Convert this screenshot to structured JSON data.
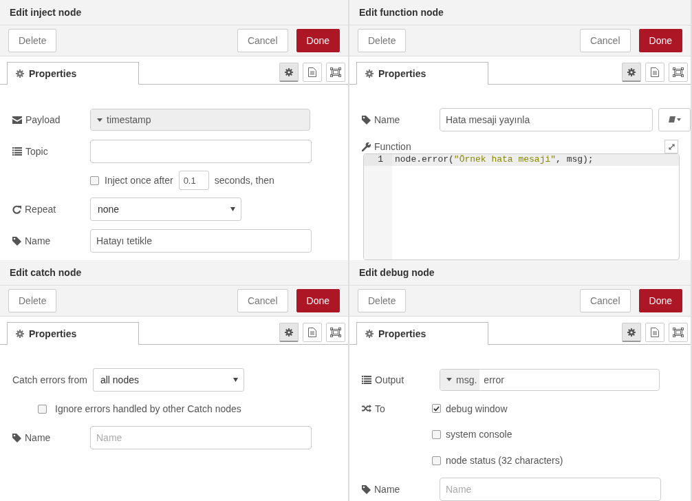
{
  "panels": [
    {
      "title": "Edit inject node",
      "buttons": {
        "delete": "Delete",
        "cancel": "Cancel",
        "done": "Done"
      },
      "tab": {
        "label": "Properties",
        "selected": true
      },
      "view_buttons": [
        {
          "selected": true
        },
        {
          "selected": false
        },
        {
          "selected": false
        }
      ],
      "rows": [
        {
          "kind": "typed",
          "label": "Payload",
          "type_label": "timestamp"
        },
        {
          "kind": "input",
          "label": "Topic"
        },
        {
          "kind": "inline-check",
          "checked": false,
          "label": "Inject once after",
          "value": "0.1",
          "suffix": "seconds, then"
        },
        {
          "kind": "select",
          "label": "Repeat",
          "value": "none"
        },
        {
          "kind": "input",
          "label": "Name",
          "value": "Hatayı tetikle"
        }
      ]
    },
    {
      "title": "Edit function node",
      "buttons": {
        "delete": "Delete",
        "cancel": "Cancel",
        "done": "Done"
      },
      "tab": {
        "label": "Properties",
        "selected": true
      },
      "view_buttons": [
        {
          "selected": true
        },
        {
          "selected": false
        },
        {
          "selected": false
        }
      ],
      "rows": [
        {
          "kind": "input-lib",
          "label": "Name",
          "value": "Hata mesaji yayınla"
        },
        {
          "kind": "code",
          "label": "Function",
          "line_number": "1",
          "tokens": [
            {
              "kind": "plain",
              "text": "node.error("
            },
            {
              "kind": "string",
              "text": "\"Örnek hata mesaji\""
            },
            {
              "kind": "plain",
              "text": ", msg);"
            }
          ]
        }
      ]
    },
    {
      "title": "Edit catch node",
      "buttons": {
        "delete": "Delete",
        "cancel": "Cancel",
        "done": "Done"
      },
      "tab": {
        "label": "Properties",
        "selected": true
      },
      "view_buttons": [
        {
          "selected": true
        },
        {
          "selected": false
        },
        {
          "selected": false
        }
      ],
      "rows": [
        {
          "kind": "select-wide",
          "label": "Catch errors from",
          "value": "all nodes"
        },
        {
          "kind": "check-indent",
          "checked": false,
          "label": "Ignore errors handled by other Catch nodes"
        },
        {
          "kind": "input",
          "label": "Name",
          "placeholder": "Name"
        }
      ]
    },
    {
      "title": "Edit debug node",
      "buttons": {
        "delete": "Delete",
        "cancel": "Cancel",
        "done": "Done"
      },
      "tab": {
        "label": "Properties",
        "selected": true
      },
      "view_buttons": [
        {
          "selected": true
        },
        {
          "selected": false
        },
        {
          "selected": false
        }
      ],
      "rows": [
        {
          "kind": "typed",
          "label": "Output",
          "type_label": "msg.",
          "value": "error"
        },
        {
          "kind": "check",
          "label": "To",
          "checked": true,
          "text": "debug window"
        },
        {
          "kind": "check",
          "checked": false,
          "text": "system console"
        },
        {
          "kind": "check",
          "checked": false,
          "text": "node status (32 characters)"
        },
        {
          "kind": "input",
          "label": "Name",
          "placeholder": "Name"
        }
      ]
    }
  ]
}
